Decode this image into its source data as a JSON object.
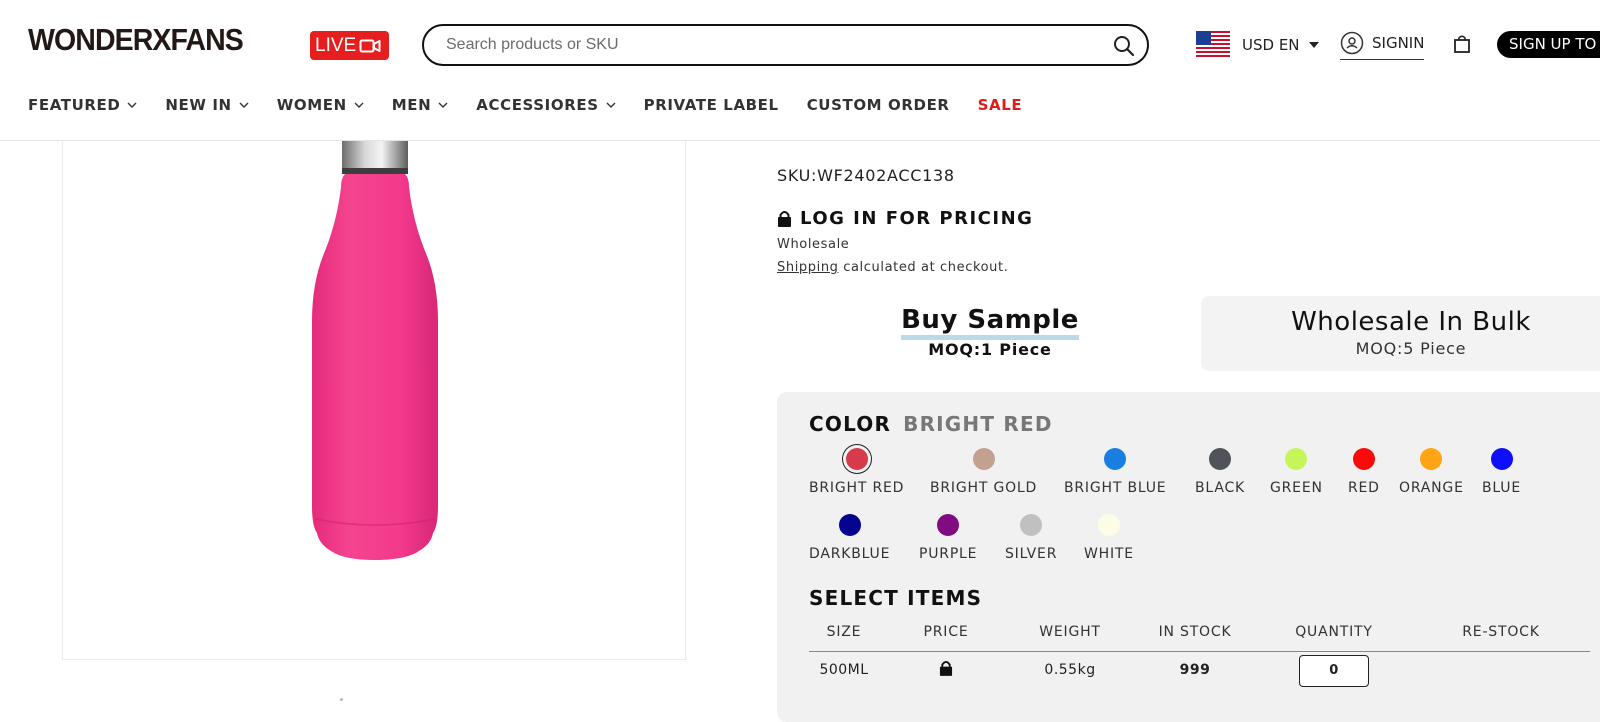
{
  "header": {
    "logo": "WONDERXFANS",
    "live_label": "LIVE",
    "search_placeholder": "Search products or SKU",
    "currency": "USD EN",
    "signin": "SIGNIN",
    "signup": "SIGN UP TO"
  },
  "nav": {
    "featured": "FEATURED",
    "new_in": "NEW IN",
    "women": "WOMEN",
    "men": "MEN",
    "accessories": "ACCESSIORES",
    "private_label": "PRIVATE LABEL",
    "custom_order": "CUSTOM ORDER",
    "sale": "SALE"
  },
  "product": {
    "sku": "SKU:WF2402ACC138",
    "login_pricing": "LOG IN FOR PRICING",
    "wholesale": "Wholesale",
    "shipping_link": "Shipping",
    "shipping_rest": " calculated at checkout.",
    "buy_sample": "Buy Sample",
    "sample_moq": "MOQ:1 Piece",
    "bulk": "Wholesale In Bulk",
    "bulk_moq": "MOQ:5 Piece",
    "bottle_color": "#f33a8c"
  },
  "color_section": {
    "label": "COLOR",
    "selected": "BRIGHT RED",
    "swatches": [
      {
        "name": "BRIGHT RED",
        "color": "#d73a4a"
      },
      {
        "name": "BRIGHT GOLD",
        "color": "#c4a08f"
      },
      {
        "name": "BRIGHT BLUE",
        "color": "#1a7ee0"
      },
      {
        "name": "BLACK",
        "color": "#50535a"
      },
      {
        "name": "GREEN",
        "color": "#c5f55a"
      },
      {
        "name": "RED",
        "color": "#fb0a0a"
      },
      {
        "name": "ORANGE",
        "color": "#ffa514"
      },
      {
        "name": "BLUE",
        "color": "#0e0efb"
      },
      {
        "name": "DARKBLUE",
        "color": "#03038e"
      },
      {
        "name": "PURPLE",
        "color": "#810b81"
      },
      {
        "name": "SILVER",
        "color": "#c0c0c0"
      },
      {
        "name": "WHITE",
        "color": "#fdfde6"
      }
    ]
  },
  "items": {
    "label": "SELECT ITEMS",
    "headers": {
      "size": "SIZE",
      "price": "PRICE",
      "weight": "WEIGHT",
      "in_stock": "IN STOCK",
      "quantity": "QUANTITY",
      "restock": "RE-STOCK"
    },
    "row": {
      "size": "500ML",
      "weight": "0.55kg",
      "in_stock": "999",
      "quantity": "0"
    }
  }
}
